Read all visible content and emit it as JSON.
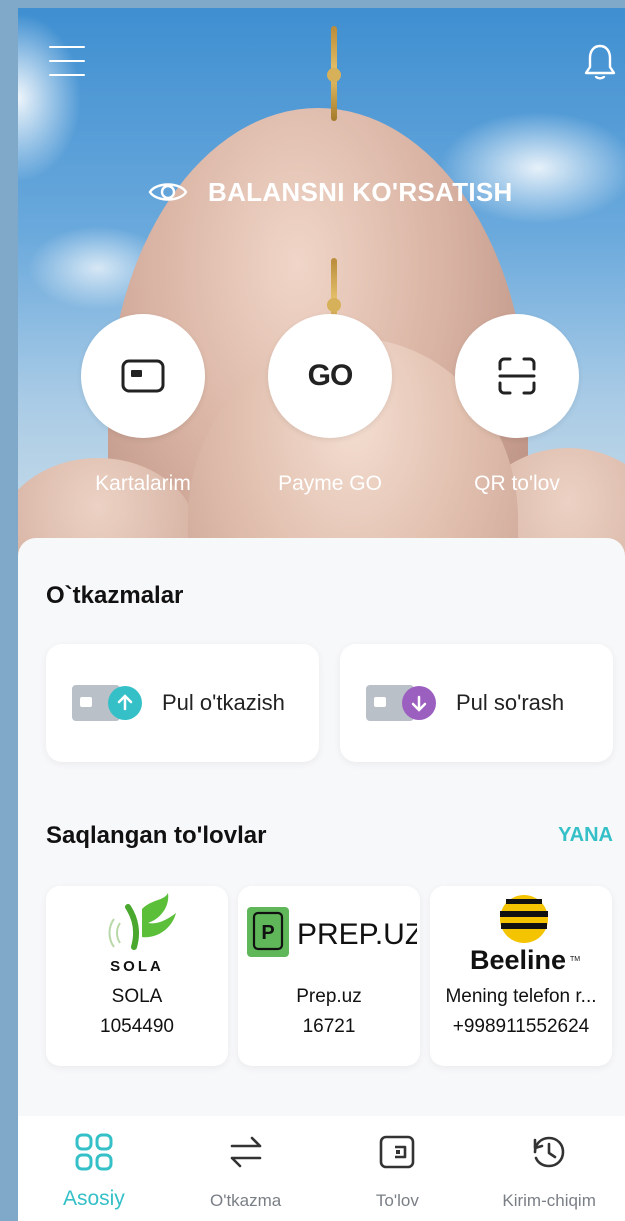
{
  "header": {
    "menu_icon": "hamburger-menu-icon",
    "bell_icon": "bell-icon",
    "balance_label": "BALANSNI KO'RSATISH"
  },
  "actions": [
    {
      "label": "Kartalarim",
      "icon": "card-icon"
    },
    {
      "label": "Payme GO",
      "icon": "go-icon",
      "icon_text": "GO"
    },
    {
      "label": "QR to'lov",
      "icon": "qr-scan-icon"
    }
  ],
  "transfers": {
    "title": "O`tkazmalar",
    "items": [
      {
        "label": "Pul o'tkazish",
        "icon": "send-money-icon",
        "color": "#35c0c8"
      },
      {
        "label": "Pul so'rash",
        "icon": "request-money-icon",
        "color": "#9b5fc0"
      }
    ]
  },
  "saved_payments": {
    "title": "Saqlangan to'lovlar",
    "more_label": "YANA",
    "items": [
      {
        "logo_text": "SOLA",
        "name": "SOLA",
        "number": "1054490"
      },
      {
        "logo_text": "PREP.UZ",
        "name": "Prep.uz",
        "number": "16721"
      },
      {
        "logo_text": "Beeline",
        "name": "Mening telefon r...",
        "number": "+998911552624"
      }
    ]
  },
  "nav": [
    {
      "label": "Asosiy",
      "icon": "home-grid-icon",
      "active": true
    },
    {
      "label": "O'tkazma",
      "icon": "transfer-arrows-icon",
      "active": false
    },
    {
      "label": "To'lov",
      "icon": "wallet-icon",
      "active": false
    },
    {
      "label": "Kirim-chiqim",
      "icon": "history-icon",
      "active": false
    }
  ],
  "colors": {
    "accent": "#35c0c8",
    "request": "#9b5fc0"
  }
}
